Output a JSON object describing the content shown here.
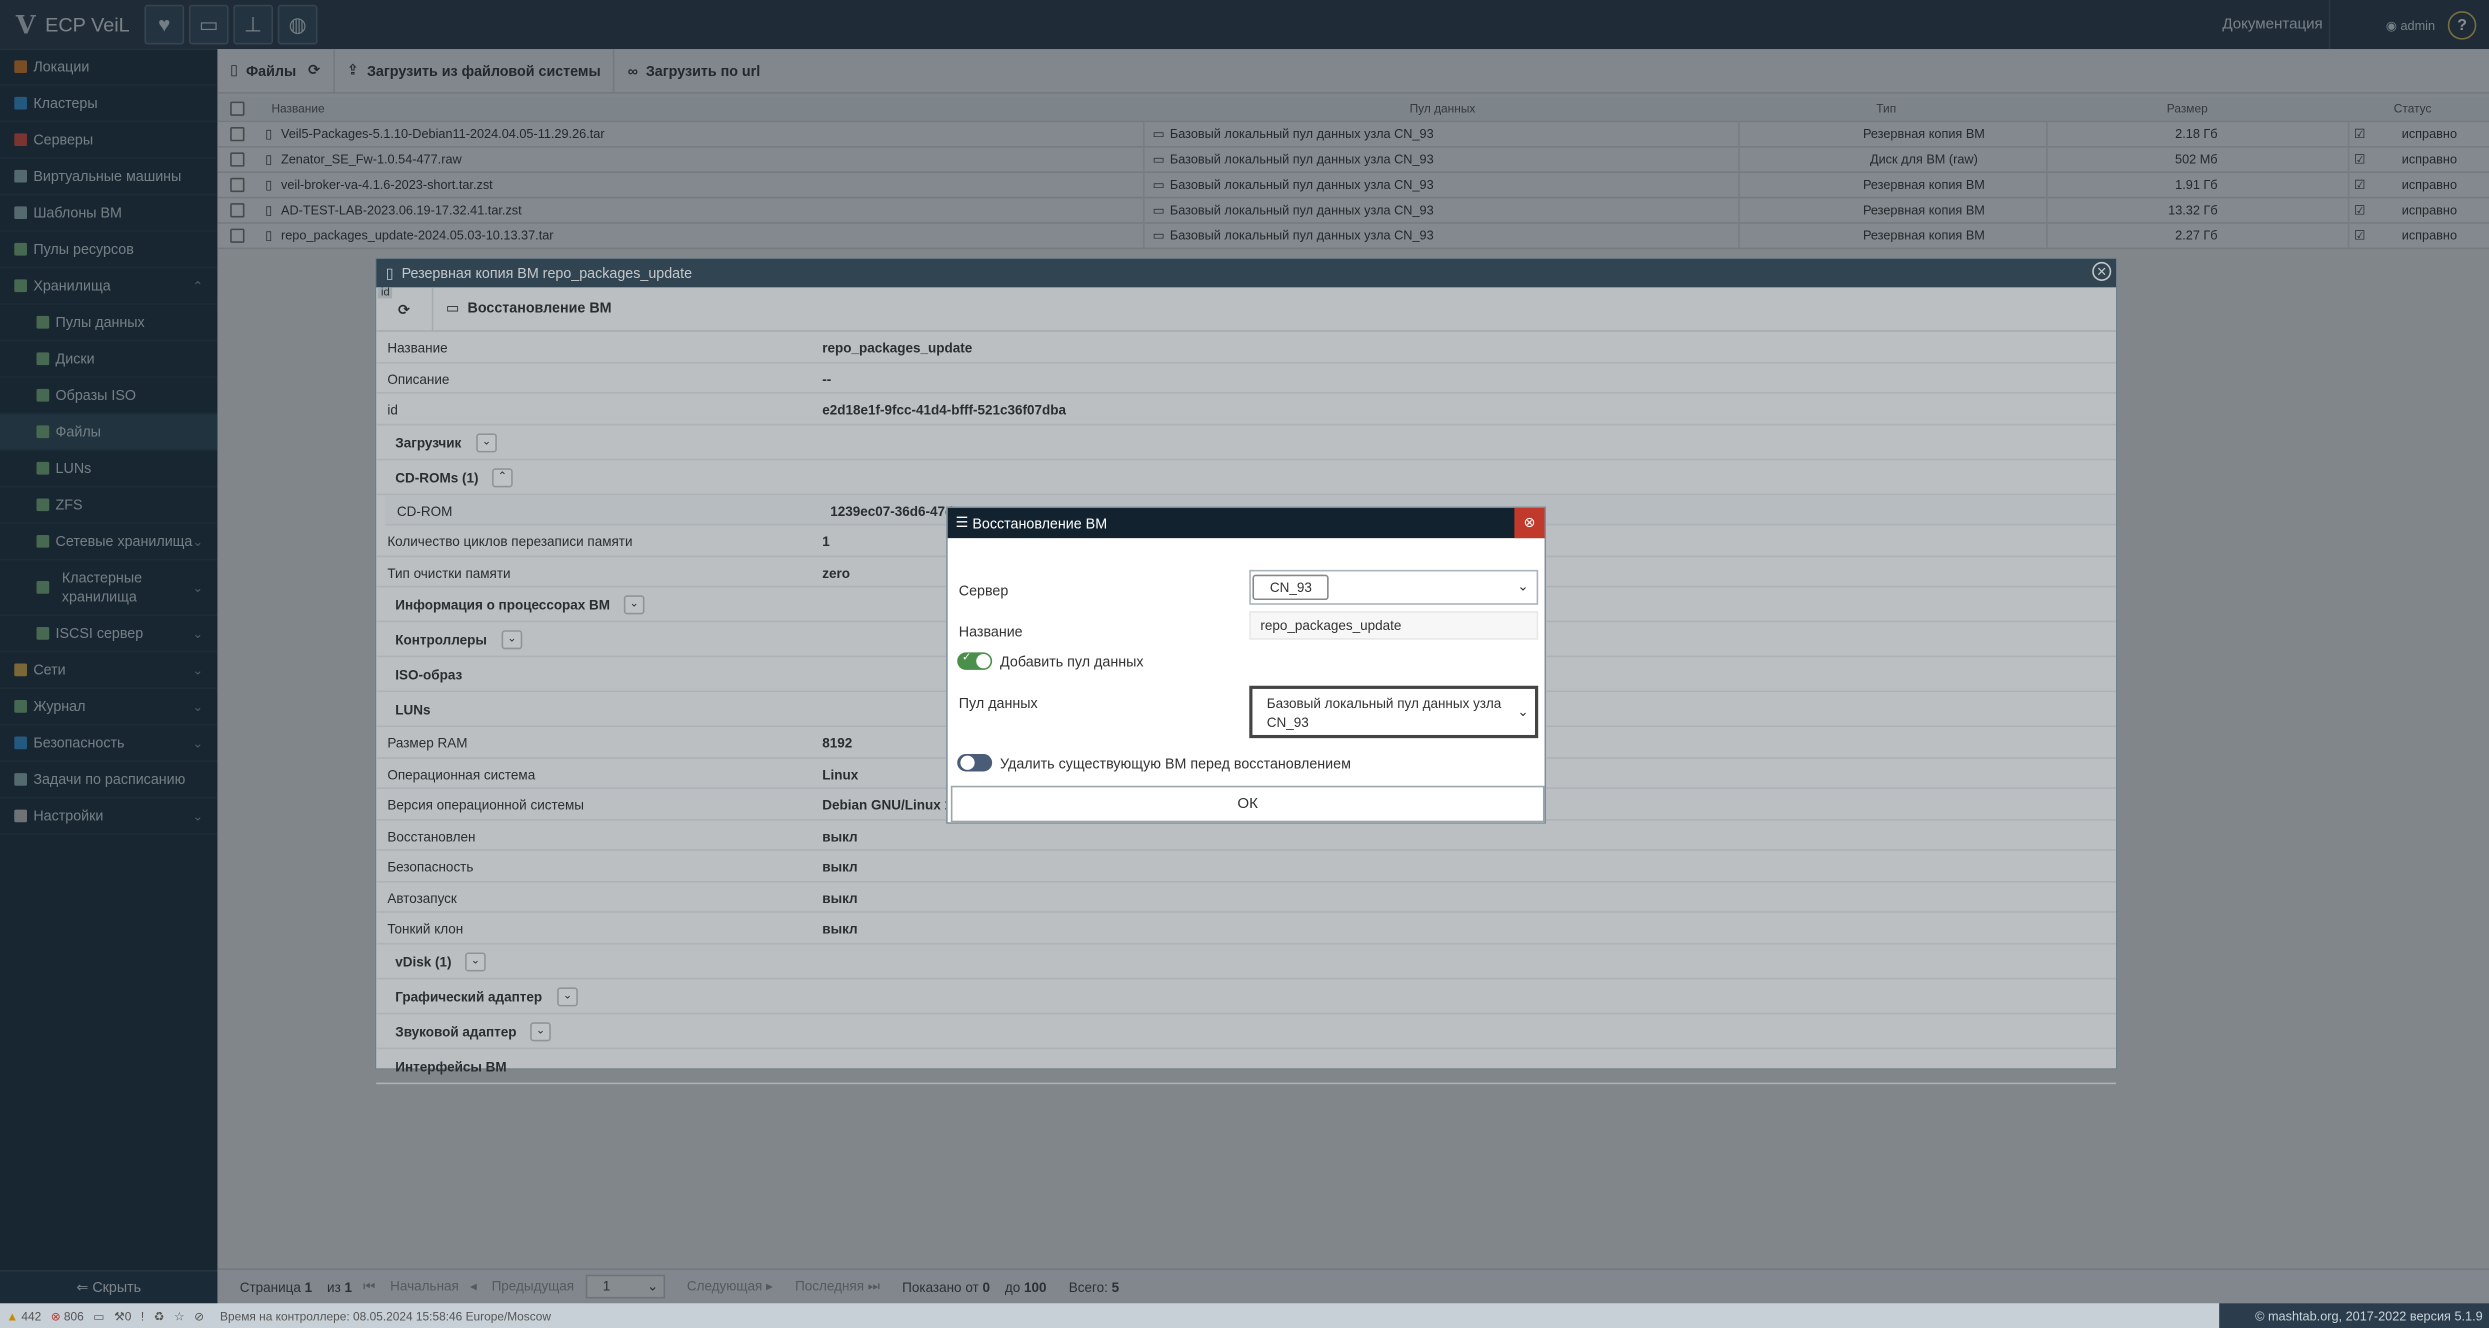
{
  "app": {
    "title": "ECP VeiL",
    "docs": "Документация",
    "user": "admin",
    "help": "?"
  },
  "sidebar": {
    "items": [
      {
        "label": "Локации",
        "color": "#e67e22",
        "chev": false,
        "sub": false,
        "active": false
      },
      {
        "label": "Кластеры",
        "color": "#3498db",
        "chev": false,
        "sub": false,
        "active": false
      },
      {
        "label": "Серверы",
        "color": "#e74c3c",
        "chev": false,
        "sub": false,
        "active": false
      },
      {
        "label": "Виртуальные машины",
        "color": "#9bb",
        "chev": false,
        "sub": false,
        "active": false
      },
      {
        "label": "Шаблоны ВМ",
        "color": "#9bb",
        "chev": false,
        "sub": false,
        "active": false
      },
      {
        "label": "Пулы ресурсов",
        "color": "#7fb87f",
        "chev": false,
        "sub": false,
        "active": false
      },
      {
        "label": "Хранилища",
        "color": "#7fb87f",
        "chev": true,
        "sub": false,
        "active": false
      },
      {
        "label": "Пулы данных",
        "color": "#7fb87f",
        "chev": false,
        "sub": true,
        "active": false
      },
      {
        "label": "Диски",
        "color": "#7fb87f",
        "chev": false,
        "sub": true,
        "active": false
      },
      {
        "label": "Образы ISO",
        "color": "#7fb87f",
        "chev": false,
        "sub": true,
        "active": false
      },
      {
        "label": "Файлы",
        "color": "#7fb87f",
        "chev": false,
        "sub": true,
        "active": true
      },
      {
        "label": "LUNs",
        "color": "#7fb87f",
        "chev": false,
        "sub": true,
        "active": false
      },
      {
        "label": "ZFS",
        "color": "#7fb87f",
        "chev": false,
        "sub": true,
        "active": false
      },
      {
        "label": "Сетевые хранилища",
        "color": "#7fb87f",
        "chev": true,
        "sub": true,
        "active": false
      },
      {
        "label": "Кластерные хранилища",
        "color": "#7fb87f",
        "chev": true,
        "sub": true,
        "active": false
      },
      {
        "label": "ISCSI сервер",
        "color": "#7fb87f",
        "chev": true,
        "sub": true,
        "active": false
      },
      {
        "label": "Сети",
        "color": "#e6b84a",
        "chev": true,
        "sub": false,
        "active": false
      },
      {
        "label": "Журнал",
        "color": "#7fb87f",
        "chev": true,
        "sub": false,
        "active": false
      },
      {
        "label": "Безопасность",
        "color": "#3498db",
        "chev": true,
        "sub": false,
        "active": false
      },
      {
        "label": "Задачи по расписанию",
        "color": "#9bb",
        "chev": false,
        "sub": false,
        "active": false
      },
      {
        "label": "Настройки",
        "color": "#ccc",
        "chev": true,
        "sub": false,
        "active": false
      }
    ],
    "hide": "Скрыть"
  },
  "toolbar": {
    "files": "Файлы",
    "upload_fs": "Загрузить из файловой системы",
    "upload_url": "Загрузить по url"
  },
  "table": {
    "headers": [
      "Название",
      "Пул данных",
      "Тип",
      "Размер",
      "Статус"
    ],
    "rows": [
      [
        "Veil5-Packages-5.1.10-Debian11-2024.04.05-11.29.26.tar",
        "Базовый локальный пул данных узла CN_93",
        "Резервная копия ВМ",
        "2.18 Гб",
        "исправно"
      ],
      [
        "Zenator_SE_Fw-1.0.54-477.raw",
        "Базовый локальный пул данных узла CN_93",
        "Диск для ВМ (raw)",
        "502 Мб",
        "исправно"
      ],
      [
        "veil-broker-va-4.1.6-2023-short.tar.zst",
        "Базовый локальный пул данных узла CN_93",
        "Резервная копия ВМ",
        "1.91 Гб",
        "исправно"
      ],
      [
        "AD-TEST-LAB-2023.06.19-17.32.41.tar.zst",
        "Базовый локальный пул данных узла CN_93",
        "Резервная копия ВМ",
        "13.32 Гб",
        "исправно"
      ],
      [
        "repo_packages_update-2024.05.03-10.13.37.tar",
        "Базовый локальный пул данных узла CN_93",
        "Резервная копия ВМ",
        "2.27 Гб",
        "исправно"
      ]
    ]
  },
  "pager": {
    "page": "Страница",
    "page_num": "1",
    "of": "из",
    "total_pages": "1",
    "first": "Начальная",
    "prev": "Предыдущая",
    "select": "1",
    "next": "Следующая",
    "last": "Последняя",
    "shown": "Показано от",
    "from": "0",
    "to_word": "до",
    "to": "100",
    "total_label": "Всего:",
    "total": "5"
  },
  "status": {
    "warn": "442",
    "err": "806",
    "n0": "0",
    "time": "Время на контроллере: 08.05.2024 15:58:46 Europe/Moscow",
    "copyright": "© mashtab.org, 2017-2022 версия 5.1.9"
  },
  "window": {
    "title": "Резервная копия ВМ repo_packages_update",
    "badge": "id",
    "restore": "Восстановление ВМ",
    "props": [
      {
        "k": "Название",
        "v": "repo_packages_update",
        "sec": false
      },
      {
        "k": "Описание",
        "v": "--",
        "sec": false
      },
      {
        "k": "id",
        "v": "e2d18e1f-9fcc-41d4-bfff-521c36f07dba",
        "sec": false
      },
      {
        "k": "Загрузчик",
        "v": "",
        "sec": true,
        "btn": "⌄"
      },
      {
        "k": "CD-ROMs (1)",
        "v": "",
        "sec": true,
        "btn": "⌃"
      },
      {
        "k": "CD-ROM",
        "v": "1239ec07-36d6-47d0",
        "sec": false,
        "inner": true
      },
      {
        "k": "Количество циклов перезаписи памяти",
        "v": "1",
        "sec": false
      },
      {
        "k": "Тип очистки памяти",
        "v": "zero",
        "sec": false
      },
      {
        "k": "Информация о процессорах ВМ",
        "v": "",
        "sec": true,
        "btn": "⌄"
      },
      {
        "k": "Контроллеры",
        "v": "",
        "sec": true,
        "btn": "⌄"
      },
      {
        "k": "ISO-образ",
        "v": "",
        "sec": true
      },
      {
        "k": "LUNs",
        "v": "",
        "sec": true
      },
      {
        "k": "Размер RAM",
        "v": "8192",
        "sec": false
      },
      {
        "k": "Операционная система",
        "v": "Linux",
        "sec": false
      },
      {
        "k": "Версия операционной системы",
        "v": "Debian GNU/Linux 11",
        "sec": false
      },
      {
        "k": "Восстановлен",
        "v": "выкл",
        "sec": false
      },
      {
        "k": "Безопасность",
        "v": "выкл",
        "sec": false
      },
      {
        "k": "Автозапуск",
        "v": "выкл",
        "sec": false
      },
      {
        "k": "Тонкий клон",
        "v": "выкл",
        "sec": false
      },
      {
        "k": "vDisk (1)",
        "v": "",
        "sec": true,
        "btn": "⌄"
      },
      {
        "k": "Графический адаптер",
        "v": "",
        "sec": true,
        "btn": "⌄"
      },
      {
        "k": "Звуковой адаптер",
        "v": "",
        "sec": true,
        "btn": "⌄"
      },
      {
        "k": "Интерфейсы ВМ",
        "v": "",
        "sec": true
      }
    ]
  },
  "dialog": {
    "title": "Восстановление ВМ",
    "server_label": "Сервер",
    "server_value": "CN_93",
    "name_label": "Название",
    "name_value": "repo_packages_update",
    "add_pool": "Добавить пул данных",
    "pool_label": "Пул данных",
    "pool_value": "Базовый локальный пул данных узла CN_93",
    "delete_existing": "Удалить существующую ВМ перед восстановлением",
    "ok": "ОК",
    "add_pool_on": true,
    "delete_on": false
  }
}
